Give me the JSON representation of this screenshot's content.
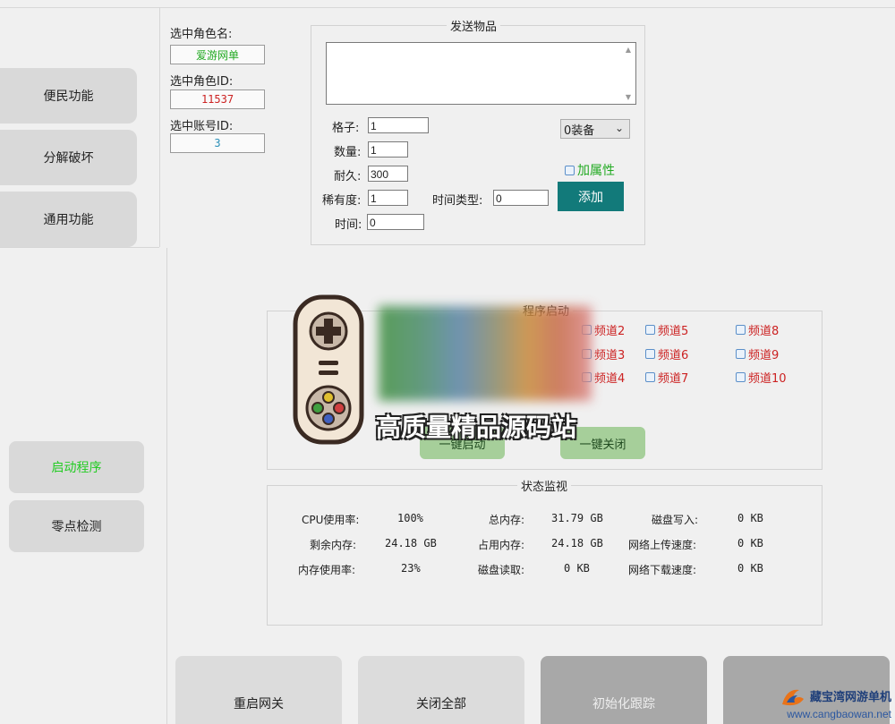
{
  "nav": {
    "items": [
      {
        "label": "便民功能"
      },
      {
        "label": "分解破坏"
      },
      {
        "label": "通用功能"
      }
    ]
  },
  "selected": {
    "role_name_label": "选中角色名:",
    "role_name_value": "爱游网单",
    "role_id_label": "选中角色ID:",
    "role_id_value": "11537",
    "account_id_label": "选中账号ID:",
    "account_id_value": "3"
  },
  "send_item": {
    "title": "发送物品",
    "grid_label": "格子:",
    "grid_value": "1",
    "quantity_label": "数量:",
    "quantity_value": "1",
    "durability_label": "耐久:",
    "durability_value": "300",
    "rarity_label": "稀有度:",
    "rarity_value": "1",
    "time_type_label": "时间类型:",
    "time_type_value": "0",
    "time_label": "时间:",
    "time_value": "0",
    "equip_select": "0装备",
    "add_attr_label": "加属性",
    "add_button": "添加"
  },
  "channels": {
    "title": "程序启动",
    "items": [
      "频道2",
      "频道3",
      "频道4",
      "频道5",
      "频道6",
      "频道7",
      "频道8",
      "频道9",
      "频道10"
    ],
    "start_all": "一键启动",
    "close_all": "一键关闭"
  },
  "side": {
    "start_program": "启动程序",
    "zero_check": "零点检测"
  },
  "status": {
    "title": "状态监视",
    "cpu_label": "CPU使用率:",
    "cpu_value": "100%",
    "free_mem_label": "剩余内存:",
    "free_mem_value": "24.18 GB",
    "mem_usage_label": "内存使用率:",
    "mem_usage_value": "23%",
    "total_mem_label": "总内存:",
    "total_mem_value": "31.79 GB",
    "used_mem_label": "占用内存:",
    "used_mem_value": "24.18 GB",
    "disk_read_label": "磁盘读取:",
    "disk_read_value": "0 KB",
    "disk_write_label": "磁盘写入:",
    "disk_write_value": "0 KB",
    "net_up_label": "网络上传速度:",
    "net_up_value": "0 KB",
    "net_down_label": "网络下载速度:",
    "net_down_value": "0 KB"
  },
  "bottom": {
    "restart_gateway": "重启网关",
    "close_all": "关闭全部",
    "init_tracking": "初始化跟踪"
  },
  "watermark": {
    "banner": "高质量精品源码站",
    "site_name": "藏宝湾网游单机",
    "site_url": "www.cangbaowan.net"
  },
  "colors": {
    "role_name": "#22aa22",
    "role_id": "#cc2222",
    "account_id": "#2a8fb8",
    "add_button": "#127a7a",
    "start_program": "#22cc22",
    "channel_text": "#cc2222",
    "green_button": "#a6cf9a"
  }
}
